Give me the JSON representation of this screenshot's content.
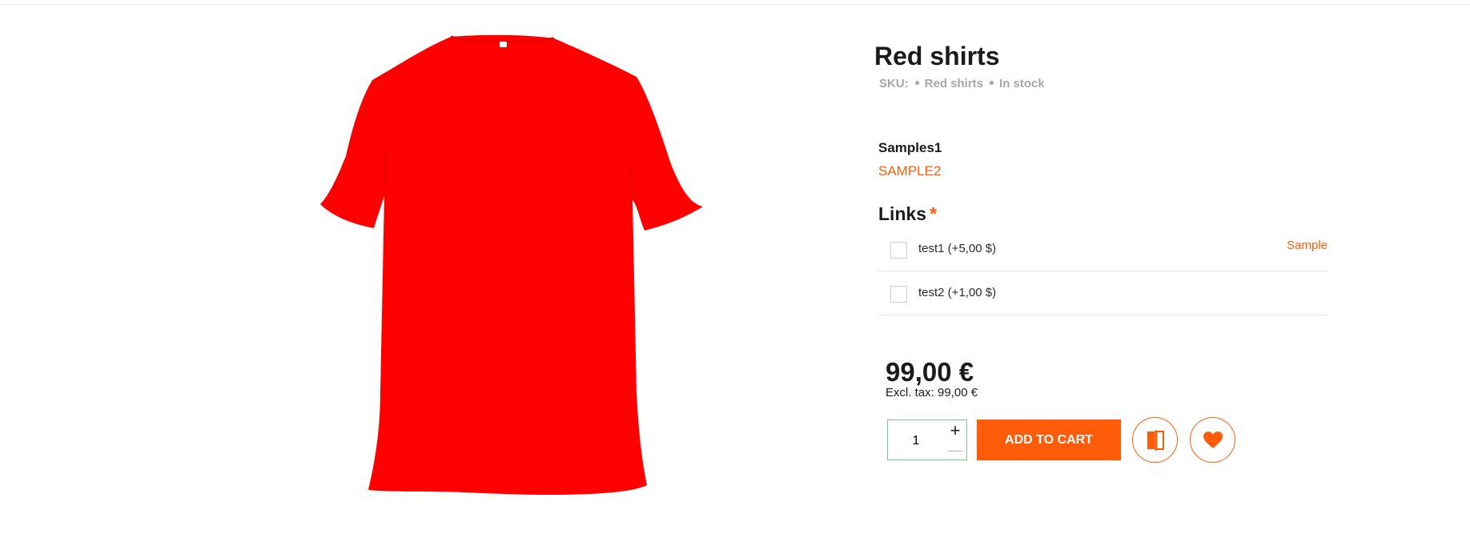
{
  "product": {
    "title": "Red shirts",
    "sku_label": "SKU:",
    "sku_value": "Red shirts",
    "stock_status": "In stock",
    "image_icon": "red-tshirt-image",
    "image_color": "#ff0000"
  },
  "samples": {
    "title": "Samples1",
    "link": "SAMPLE2"
  },
  "links": {
    "heading": "Links",
    "required_mark": "*",
    "items": [
      {
        "label": "test1 (+5,00 $)",
        "sample": "Sample",
        "checked": false
      },
      {
        "label": "test2 (+1,00 $)",
        "sample": "",
        "checked": false
      }
    ]
  },
  "pricing": {
    "price": "99,00 €",
    "excl_tax": "Excl. tax: 99,00 €"
  },
  "cart": {
    "quantity": "1",
    "plus_symbol": "+",
    "minus_symbol": "—",
    "add_to_cart_label": "ADD TO CART",
    "compare_icon": "compare-icon",
    "wishlist_icon": "heart-icon"
  },
  "colors": {
    "accent": "#ff5c0a",
    "qty_border": "#7bc68f",
    "muted": "#a7a7a7"
  }
}
